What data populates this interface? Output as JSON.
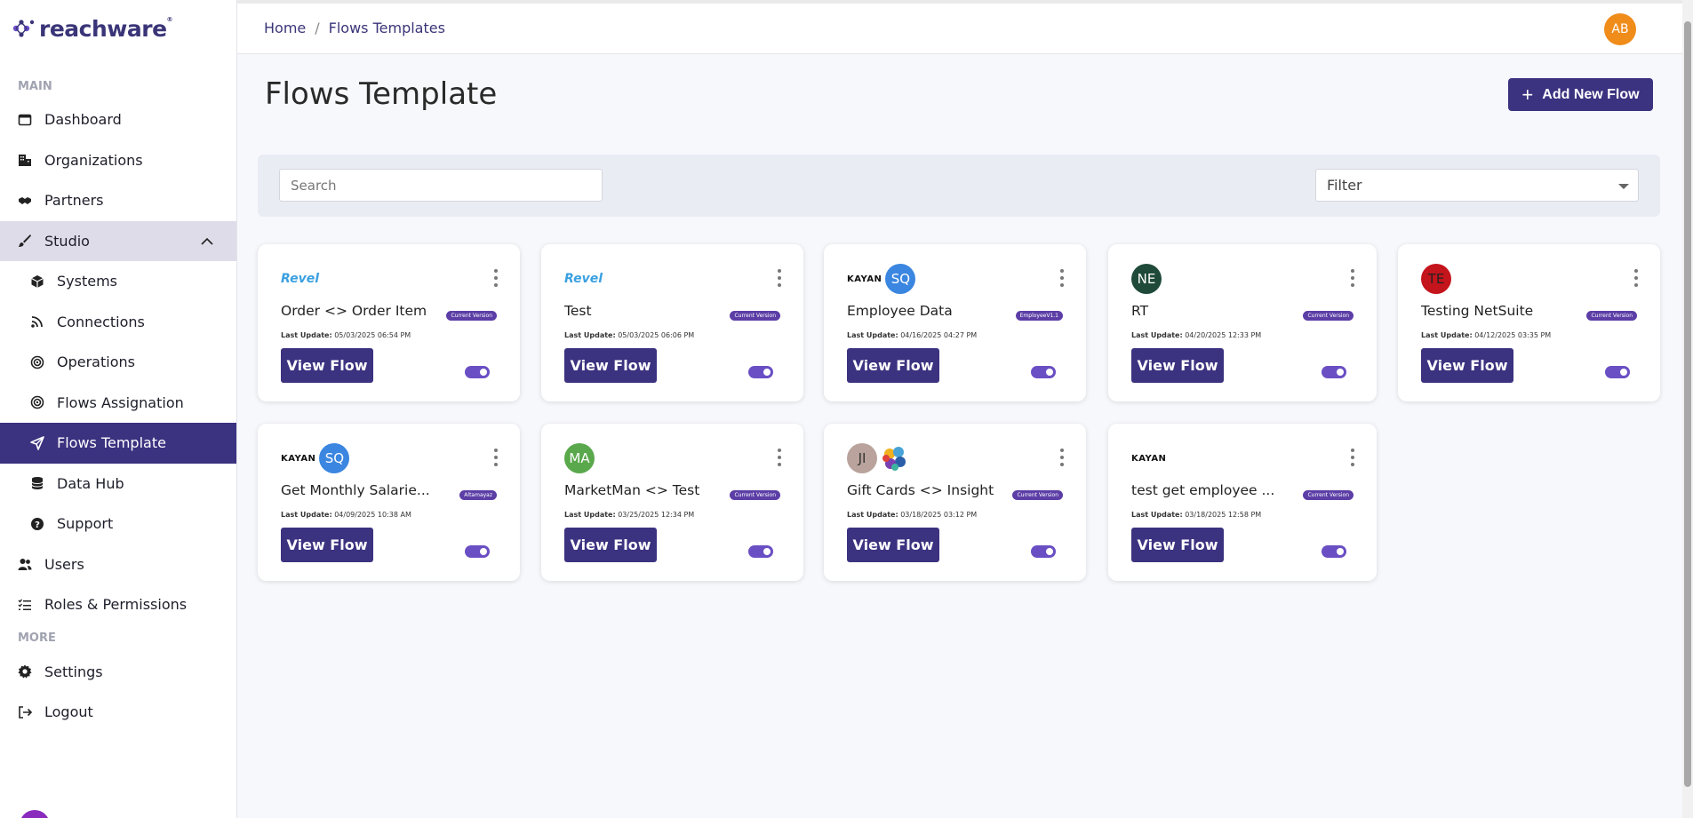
{
  "brand": {
    "name": "reachware",
    "mark": "®"
  },
  "sidebar": {
    "section_main": "MAIN",
    "section_more": "MORE",
    "items": [
      {
        "label": "Dashboard",
        "icon": "dashboard-icon"
      },
      {
        "label": "Organizations",
        "icon": "building-icon"
      },
      {
        "label": "Partners",
        "icon": "handshake-icon"
      },
      {
        "label": "Studio",
        "icon": "brush-icon"
      },
      {
        "label": "Systems",
        "icon": "cube-icon"
      },
      {
        "label": "Connections",
        "icon": "rss-icon"
      },
      {
        "label": "Operations",
        "icon": "target-icon"
      },
      {
        "label": "Flows Assignation",
        "icon": "target-icon"
      },
      {
        "label": "Flows Template",
        "icon": "send-icon"
      },
      {
        "label": "Data Hub",
        "icon": "database-icon"
      },
      {
        "label": "Support",
        "icon": "help-icon"
      },
      {
        "label": "Users",
        "icon": "users-icon"
      },
      {
        "label": "Roles & Permissions",
        "icon": "list-check-icon"
      },
      {
        "label": "Settings",
        "icon": "gear-icon"
      },
      {
        "label": "Logout",
        "icon": "logout-icon"
      }
    ]
  },
  "header": {
    "breadcrumb": [
      "Home",
      "/",
      "Flows Templates"
    ],
    "user_initials": "AB"
  },
  "page": {
    "title": "Flows Template",
    "add_button": "Add New Flow",
    "search_placeholder": "Search",
    "filter_label": "Filter"
  },
  "view_label": "View Flow",
  "last_update_label": "Last Update:",
  "cards": [
    {
      "logo": "Revel",
      "title": "Order <> Order Item",
      "badge": "Current Version",
      "date": "05/03/2025 06:54 PM"
    },
    {
      "logo": "Revel",
      "title": "Test",
      "badge": "Current Version",
      "date": "05/03/2025 06:06 PM"
    },
    {
      "logo_text": "KAYAN",
      "circle": "SQ",
      "title": "Employee Data",
      "badge": "EmployeeV1.1",
      "date": "04/16/2025 04:27 PM"
    },
    {
      "circle": "NE",
      "title": "RT",
      "badge": "Current Version",
      "date": "04/20/2025 12:33 PM"
    },
    {
      "circle": "TE",
      "title": "Testing NetSuite",
      "badge": "Current Version",
      "date": "04/12/2025 03:35 PM"
    },
    {
      "logo_text": "KAYAN",
      "circle": "SQ",
      "title": "Get Monthly Salarie...",
      "badge": "Altamayaz",
      "date": "04/09/2025 10:38 AM"
    },
    {
      "circle": "MA",
      "title": "MarketMan <> Test",
      "badge": "Current Version",
      "date": "03/25/2025 12:34 PM"
    },
    {
      "circle": "JI",
      "title": "Gift Cards <> Insight",
      "badge": "Current Version",
      "date": "03/18/2025 03:12 PM"
    },
    {
      "logo_text": "KAYAN",
      "title": "test get employee ...",
      "badge": "Current Version",
      "date": "03/18/2025 12:58 PM"
    }
  ],
  "colors": {
    "primary": "#3b3280",
    "badge": "#5c3ea6",
    "toggle": "#6a4fc4",
    "avatar_user": "#f08c1a",
    "circle_sq": "#3a86e0",
    "circle_ne": "#1f4a3a",
    "circle_te": "#c4141c",
    "circle_ma": "#5aa84c",
    "circle_ji": "#b9a39c"
  }
}
